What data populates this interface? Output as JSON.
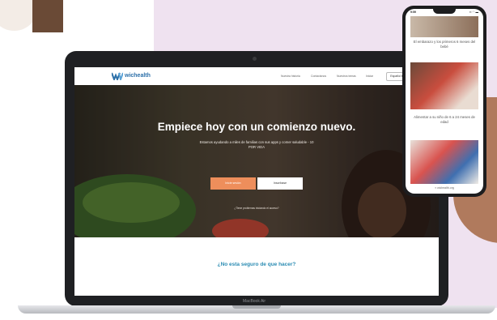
{
  "site": {
    "logo_text": "wichealth",
    "nav_links": [
      "Nuestra historia",
      "Contáctanos",
      "Nuestros temas",
      "Iniciar"
    ],
    "language_button": "Español ▾",
    "hero_title": "Empiece hoy con un comienzo nuevo.",
    "hero_subtitle": "Estamos ayudando a miles de familias con sus apps y comer saludable - 10 POR VIDA",
    "primary_button": "Inicie sesión",
    "secondary_button": "Inscríbase",
    "hero_small_link": "¿Tiene problemas iniciando el acceso?",
    "question": "¿No esta seguro de que hacer?"
  },
  "laptop": {
    "brand": "MacBook Air"
  },
  "phone": {
    "time": "9:59",
    "status": "▪▪ ◠ ▬",
    "card1_caption": "El embarazo y los primeros 6 meses del bebé",
    "card2_caption": "Alimentar a su niño de 6 a 24 meses de edad",
    "footer": "≡ wichealth.org"
  },
  "colors": {
    "accent_blue": "#2b8cb3",
    "orange_button": "#ee8e5b",
    "lilac_background": "#efe2f0"
  }
}
